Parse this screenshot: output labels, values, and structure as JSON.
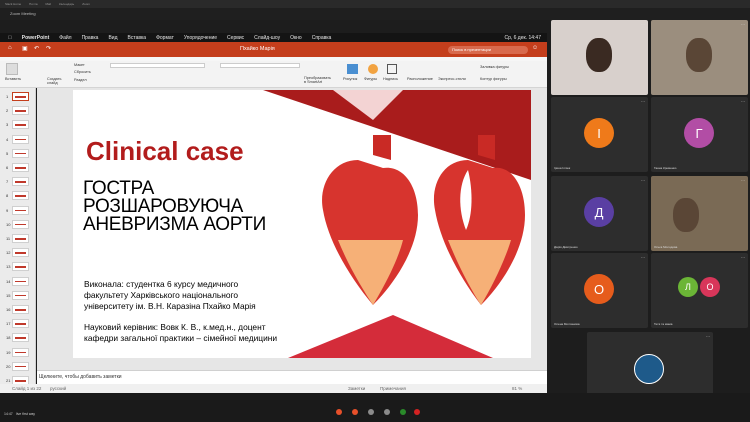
{
  "browser_tabs": [
    "Slack Home",
    "Почта",
    "Mail",
    "Календарь",
    "Zoom"
  ],
  "zoom_window_title": "Zoom Meeting",
  "mac_menu": {
    "app": "PowerPoint",
    "items": [
      "Файл",
      "Правка",
      "Вид",
      "Вставка",
      "Формат",
      "Упорядочение",
      "Сервис",
      "Слайд-шоу",
      "Окно",
      "Справка"
    ],
    "clock": "Ср, 6 дек. 14:47"
  },
  "ppt": {
    "doc_title": "Пхайко Марія",
    "search_placeholder": "Поиск в презентации",
    "ribbon": {
      "paste": "Вставить",
      "new_slide": "Создать\nслайд",
      "layout": "Макет",
      "reset": "Сбросить",
      "section": "Раздел",
      "convert": "Преобразовать\nв SmartArt",
      "picture": "Рисунок",
      "shapes": "Фигуры",
      "textbox": "Надпись",
      "arrange": "Расположение",
      "quick_styles": "Экспресс-стили",
      "fill": "Заливка фигуры",
      "outline": "Контур фигуры"
    },
    "slide_count": 22,
    "slide": {
      "title_red": "Clinical case",
      "subtitle_lines": [
        "ГОСТРА",
        "РОЗШАРОВУЮЧА",
        "АНЕВРИЗМА АОРТИ"
      ],
      "author_lines": [
        "Виконала: студентка 6 курсу медичного",
        "факультету Харківського національного",
        "університету ім. В.Н. Каразіна Пхайко Марія"
      ],
      "supervisor_lines": [
        "Науковий керівник: Вовк К. В., к.мед.н., доцент",
        "кафедри загальної практики – сімейної медицини"
      ]
    },
    "notes_placeholder": "Щелкните, чтобы добавить заметки",
    "status": {
      "slide_of": "Слайд 1 из 22",
      "language": "русский",
      "notes": "Заметки",
      "comments": "Примечания",
      "zoom": "81 %"
    }
  },
  "participants": [
    {
      "type": "video",
      "name": ""
    },
    {
      "type": "video",
      "name": ""
    },
    {
      "type": "avatar",
      "initial": "І",
      "color": "#ef7a1a",
      "name": "Ірина Іллюк"
    },
    {
      "type": "avatar",
      "initial": "Г",
      "color": "#b24da5",
      "name": "Ганна Кременко"
    },
    {
      "type": "avatar",
      "initial": "Д",
      "color": "#5a3fa3",
      "name": "Дарія Дмитренко"
    },
    {
      "type": "video",
      "name": "Ольга Молодова"
    },
    {
      "type": "avatar",
      "initial": "О",
      "color": "#e65c1c",
      "name": "Олена Молчанова"
    },
    {
      "type": "avatars2",
      "initials": [
        "Л",
        "О"
      ],
      "colors": [
        "#6bb536",
        "#d8365a"
      ],
      "name": "Тетя та мама"
    },
    {
      "type": "logo",
      "name": "Ваш Р"
    }
  ],
  "bottom_bar": {
    "time": "14:47",
    "text": "live first way"
  }
}
